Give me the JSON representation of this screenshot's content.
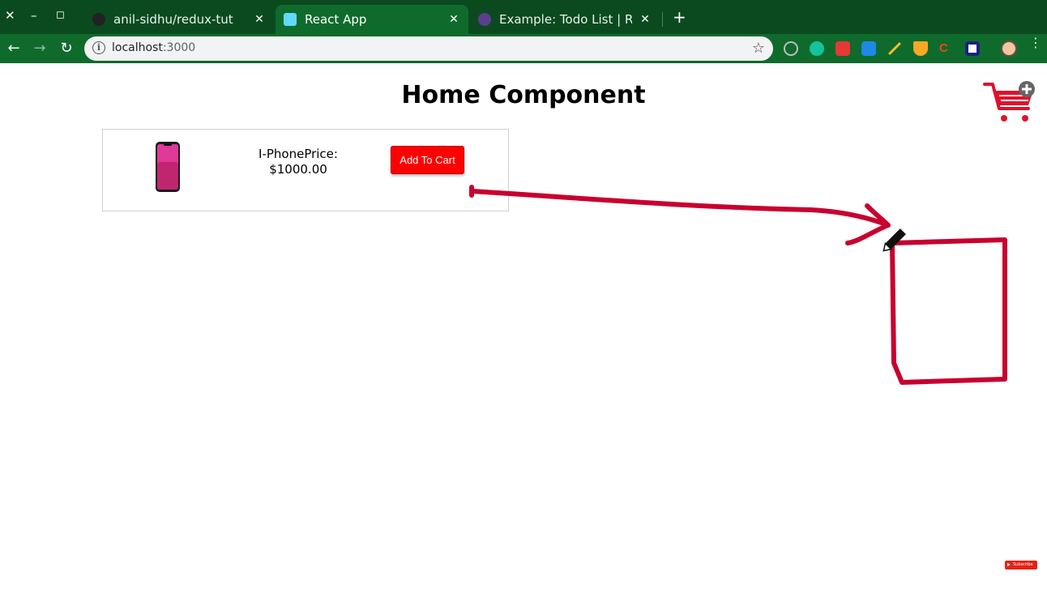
{
  "window": {
    "close_glyph": "✕",
    "minimize_glyph": "–",
    "maximize_glyph": "◻"
  },
  "tabs": [
    {
      "title": "anil-sidhu/redux-tut",
      "icon": "github-icon",
      "active": false,
      "close_glyph": "✕"
    },
    {
      "title": "React App",
      "icon": "react-icon",
      "active": true,
      "close_glyph": "✕"
    },
    {
      "title": "Example: Todo List | Redu",
      "icon": "redux-icon",
      "active": false,
      "close_glyph": "✕"
    }
  ],
  "new_tab_glyph": "+",
  "toolbar": {
    "back_glyph": "←",
    "forward_glyph": "→",
    "reload_glyph": "↻",
    "url_host": "localhost",
    "url_port": ":3000",
    "star_glyph": "☆"
  },
  "extensions": [
    {
      "name": "extension-circle-icon",
      "color": "#bdbdbd"
    },
    {
      "name": "grammarly-icon",
      "color": "#15c39a"
    },
    {
      "name": "extension-red-icon",
      "color": "#e53935"
    },
    {
      "name": "extension-n-icon",
      "color": "#1e88e5"
    },
    {
      "name": "pencil-extension-icon",
      "color": "#fbc02d"
    },
    {
      "name": "shield-extension-icon",
      "color": "#f9a825"
    },
    {
      "name": "extension-c-icon",
      "color": "#e64a19"
    },
    {
      "name": "extension-square-icon",
      "color": "#ffffff"
    },
    {
      "name": "profile-avatar-icon",
      "color": "#f0c8a0"
    }
  ],
  "page": {
    "heading": "Home Component",
    "product": {
      "name_line1": "I-PhonePrice:",
      "name_line2": "$1000.00",
      "button_label": "Add To Cart"
    },
    "badge": "Subscribe"
  },
  "colors": {
    "tabstrip": "#0b4a1f",
    "toolbar": "#0f6b2c",
    "button": "#ff0000",
    "annotation": "#c8002f"
  }
}
